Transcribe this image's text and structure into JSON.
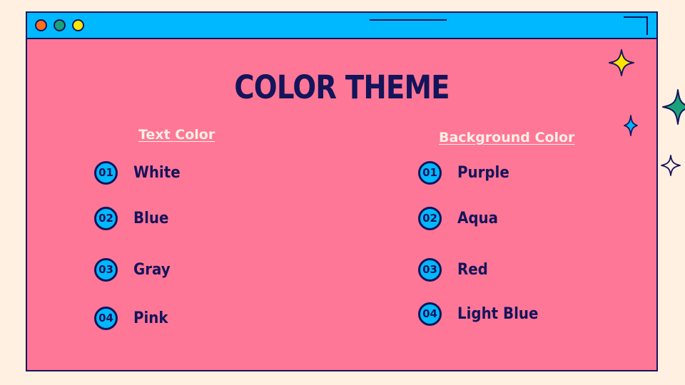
{
  "slide": {
    "title": "COLOR THEME"
  },
  "text_color": {
    "heading": "Text Color",
    "items": [
      {
        "num": "01",
        "label": "White"
      },
      {
        "num": "02",
        "label": "Blue"
      },
      {
        "num": "03",
        "label": "Gray"
      },
      {
        "num": "04",
        "label": "Pink"
      }
    ]
  },
  "background_color": {
    "heading": "Background Color",
    "items": [
      {
        "num": "01",
        "label": "Purple"
      },
      {
        "num": "02",
        "label": "Aqua"
      },
      {
        "num": "03",
        "label": "Red"
      },
      {
        "num": "04",
        "label": "Light Blue"
      }
    ]
  },
  "colors": {
    "page_bg": "#fff0e2",
    "window_bg": "#ff7797",
    "titlebar": "#00b8ff",
    "navy": "#14145a",
    "dot_orange": "#ff6d1f",
    "dot_green": "#1aa37a",
    "dot_yellow": "#ffe600"
  },
  "icons": [
    "window-dot-orange",
    "window-dot-green",
    "window-dot-yellow",
    "sparkle-yellow-icon",
    "sparkle-green-icon",
    "sparkle-blue-icon",
    "sparkle-outline-icon"
  ]
}
